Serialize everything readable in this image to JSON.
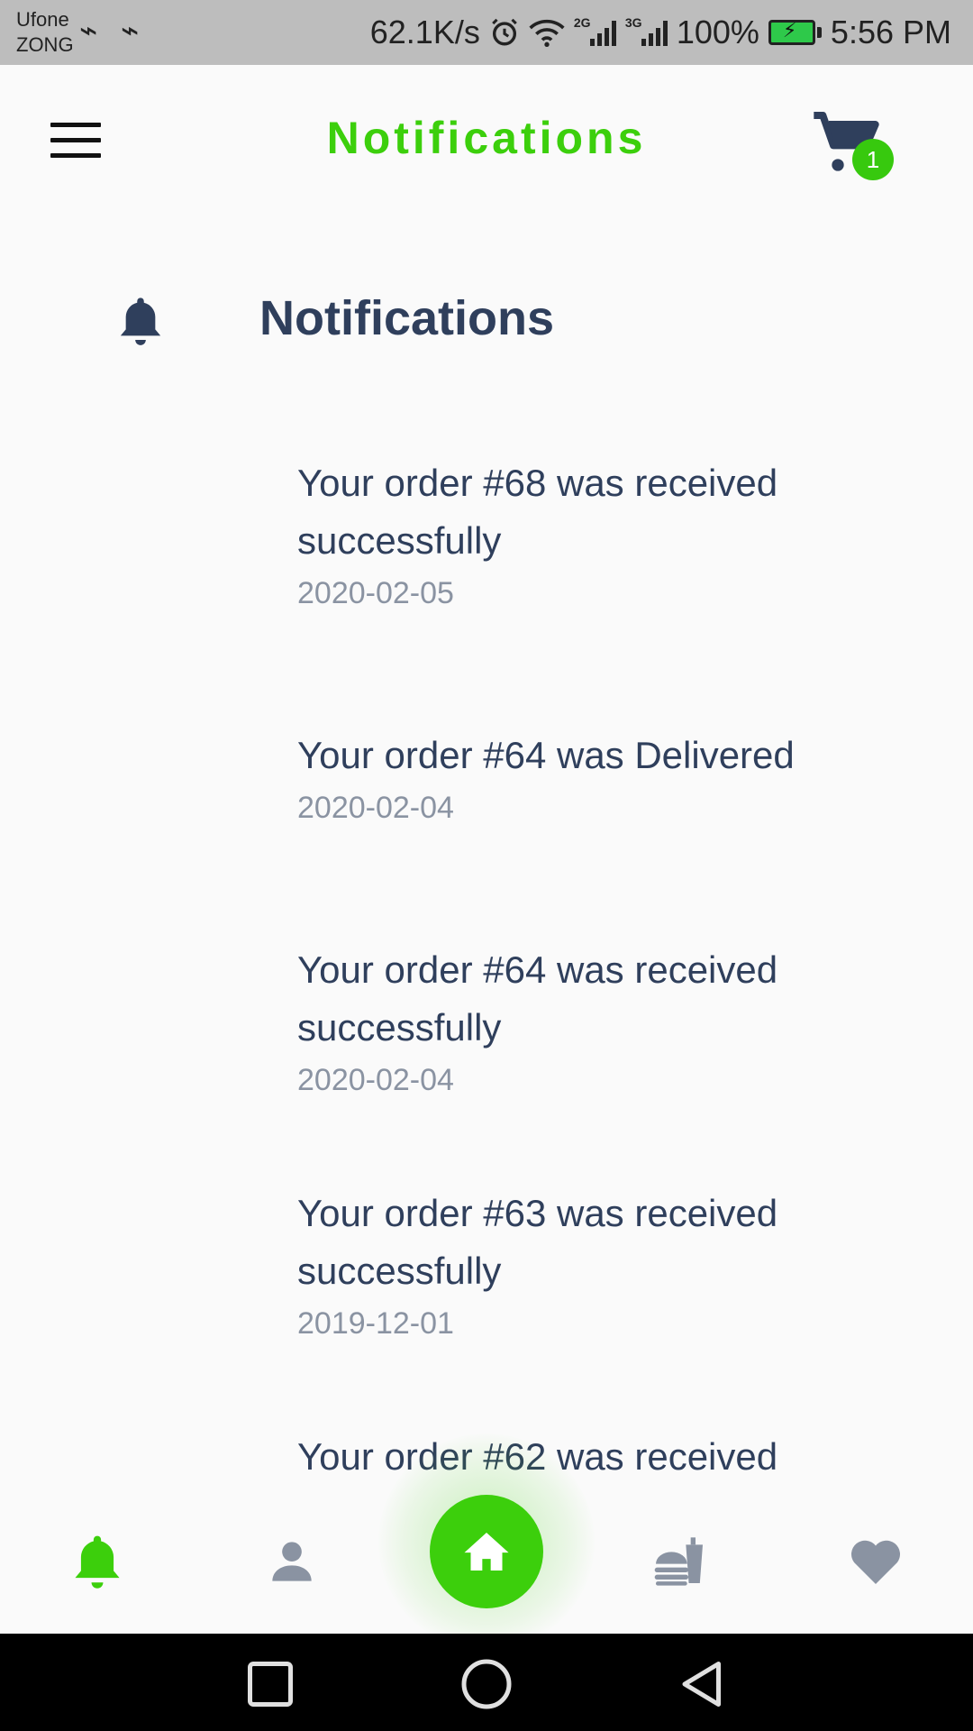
{
  "status_bar": {
    "carrier_1": "Ufone",
    "carrier_2": "ZONG",
    "usb_icon": "usb-icon",
    "net_speed": "62.1K/s",
    "sig_tag_1": "2G",
    "sig_tag_2": "3G",
    "battery": "100%",
    "time": "5:56 PM"
  },
  "app_bar": {
    "title": "Notifications",
    "cart_count": "1",
    "accent_color": "#3ccf0c"
  },
  "section": {
    "title": "Notifications"
  },
  "notifications": [
    {
      "message": "Your order #68 was received successfully",
      "date": "2020-02-05"
    },
    {
      "message": "Your order #64 was Delivered",
      "date": "2020-02-04"
    },
    {
      "message": "Your order #64 was received successfully",
      "date": "2020-02-04"
    },
    {
      "message": "Your order #63 was received successfully",
      "date": "2019-12-01"
    },
    {
      "message": "Your order #62 was received",
      "date": ""
    }
  ],
  "bottom_nav": {
    "items": [
      "bell-icon",
      "person-icon",
      "home-icon",
      "food-icon",
      "heart-icon"
    ],
    "active": "bell-icon",
    "active_color": "#3ccf0c",
    "inactive_color": "#8a93a2"
  }
}
